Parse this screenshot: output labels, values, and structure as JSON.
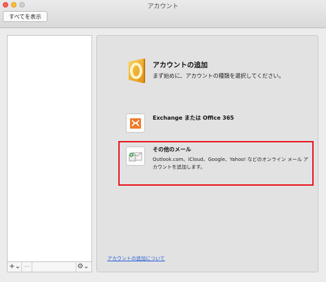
{
  "window": {
    "title": "アカウント",
    "show_all_label": "すべてを表示"
  },
  "sidebar": {
    "add_label": "+⌄",
    "remove_label": "—",
    "gear_label": "⚙⌄"
  },
  "main": {
    "add_account_title": "アカウントの追加",
    "add_account_subtitle": "まず始めに、アカウントの種類を選択してください。",
    "exchange_label": "Exchange または Office 365",
    "other_mail_title": "その他のメール",
    "other_mail_description": "Outlook.com、iCloud、Google、Yahoo! などのオンライン メール アカウントを追加します。",
    "about_link": "アカウントの追加について"
  },
  "colors": {
    "highlight": "#e8141c",
    "link": "#2a5fd6",
    "outlook_orange": "#f0a81c",
    "exchange_orange": "#f07b2a"
  },
  "icons": [
    "outlook-icon",
    "exchange-icon",
    "other-mail-icon",
    "gear-icon"
  ]
}
